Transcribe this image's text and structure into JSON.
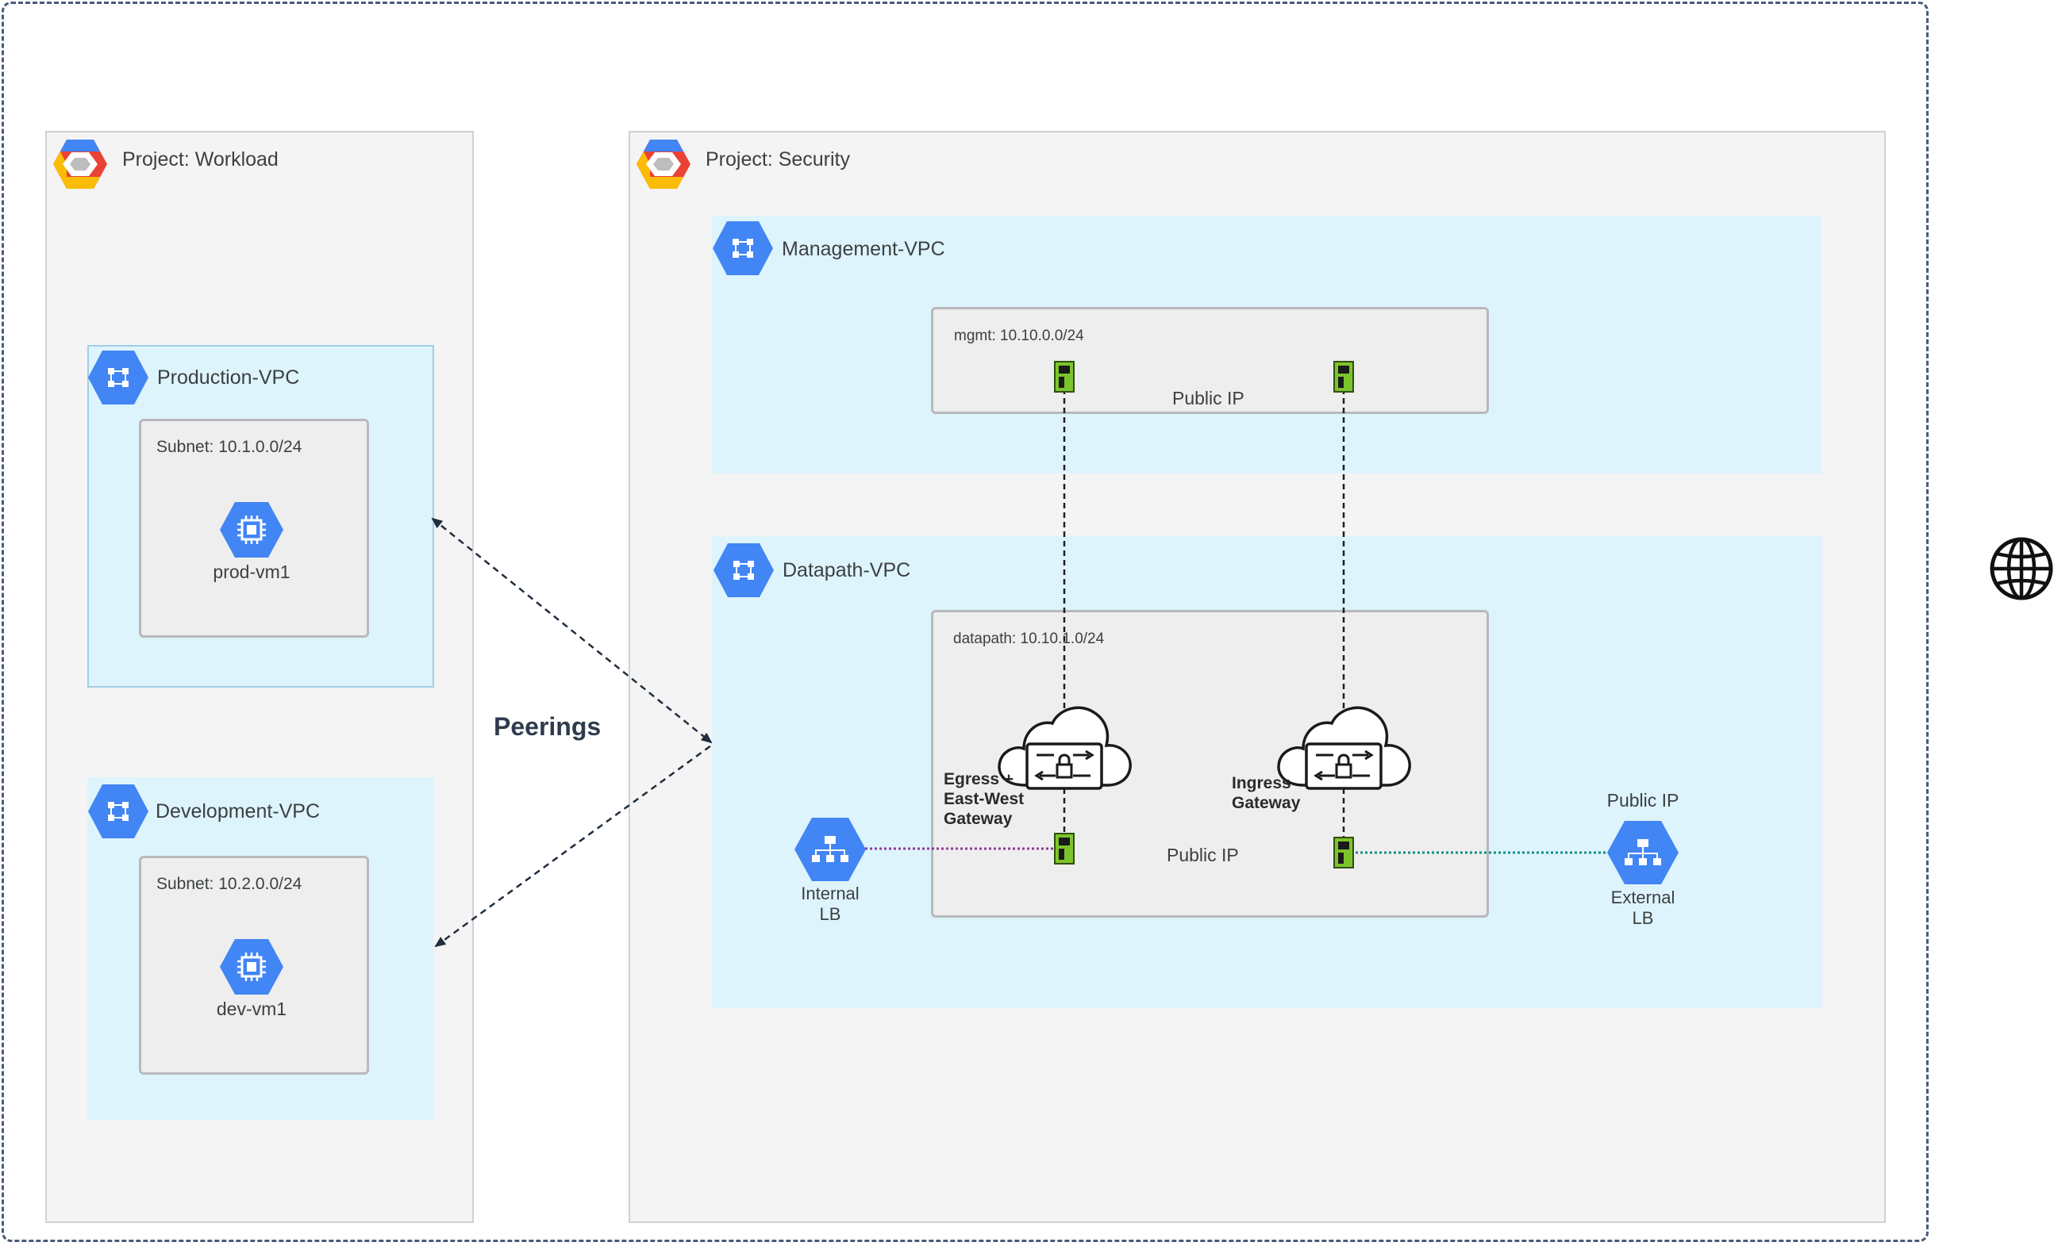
{
  "projects": {
    "workload": {
      "title": "Project: Workload"
    },
    "security": {
      "title": "Project: Security"
    }
  },
  "vpcs": {
    "production": {
      "title": "Production-VPC",
      "subnet": "Subnet:  10.1.0.0/24",
      "vm": "prod-vm1"
    },
    "development": {
      "title": "Development-VPC",
      "subnet": "Subnet:  10.2.0.0/24",
      "vm": "dev-vm1"
    },
    "management": {
      "title": "Management-VPC",
      "subnet": "mgmt: 10.10.0.0/24",
      "public_ip": "Public IP"
    },
    "datapath": {
      "title": "Datapath-VPC",
      "subnet": "datapath: 10.10.1.0/24",
      "public_ip": "Public IP"
    }
  },
  "peerings": "Peerings",
  "gateways": {
    "egress": "Egress +\nEast-West\nGateway",
    "ingress": "Ingress\nGateway"
  },
  "load_balancers": {
    "internal": "Internal\nLB",
    "external": "External\nLB",
    "external_public_ip": "Public IP"
  },
  "colors": {
    "gcp_blue": "#4285f4",
    "vpc_fill": "#def4fc",
    "project_fill": "#f4f4f4",
    "nic_green": "#7cc42b",
    "internal_link": "#8e3a9a",
    "external_link": "#0b8f86"
  },
  "icons": {
    "project": "gcp-project-logo-icon",
    "vpc": "vpc-network-icon",
    "vm": "compute-engine-icon",
    "lb": "load-balancer-icon",
    "gateway": "cloud-firewall-gateway-icon",
    "nic": "network-interface-icon",
    "internet": "globe-icon"
  }
}
